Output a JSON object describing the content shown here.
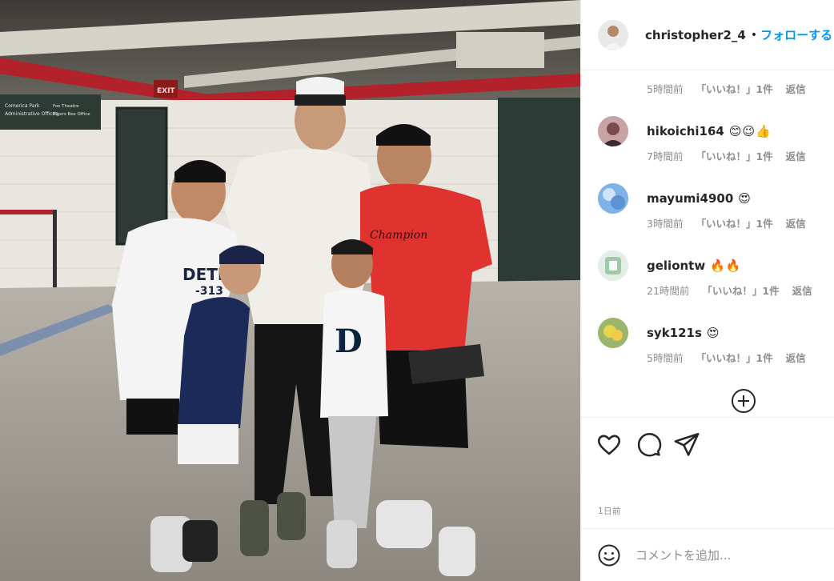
{
  "photo": {
    "alt_signs": {
      "exit": "EXIT",
      "wall_sign_line1": "Comerica Park",
      "wall_sign_line2": "Administrative Offices",
      "wall_sign_line3": "Fox Theatre",
      "wall_sign_line4": "Tigers Box Office"
    },
    "shirt_texts": {
      "left_kid": "DETR",
      "left_kid_number": "-313",
      "red_shirt": "Champion",
      "jersey": "D"
    }
  },
  "post": {
    "username": "christopher2_4",
    "separator": "•",
    "follow_label": "フォローする",
    "first_meta": {
      "time": "5時間前",
      "likes": "「いいね！」1件",
      "reply": "返信"
    },
    "comments": [
      {
        "user": "hikoichi164",
        "emoji": "😊😉👍",
        "time": "7時間前",
        "likes": "「いいね！」1件",
        "reply": "返信",
        "avatar_color": "#c9a2a6"
      },
      {
        "user": "mayumi4900",
        "emoji": "😍",
        "time": "3時間前",
        "likes": "「いいね！」1件",
        "reply": "返信",
        "avatar_color": "#7fb3e8"
      },
      {
        "user": "geliontw",
        "emoji": "🔥🔥",
        "time": "21時間前",
        "likes": "「いいね！」1件",
        "reply": "返信",
        "avatar_color": "#9fc9a8"
      },
      {
        "user": "syk121s",
        "emoji": "😍",
        "time": "5時間前",
        "likes": "「いいね！」1件",
        "reply": "返信",
        "avatar_color": "#c8c24a"
      }
    ],
    "date": "1日前",
    "comment_placeholder": "コメントを追加..."
  },
  "icons": {
    "like": "heart-icon",
    "comment": "comment-bubble-icon",
    "share": "paper-plane-icon",
    "emoji": "smiley-icon",
    "more": "plus-circle-icon"
  },
  "colors": {
    "follow": "#0095f6",
    "muted": "#8e8e8e",
    "text": "#262626"
  }
}
